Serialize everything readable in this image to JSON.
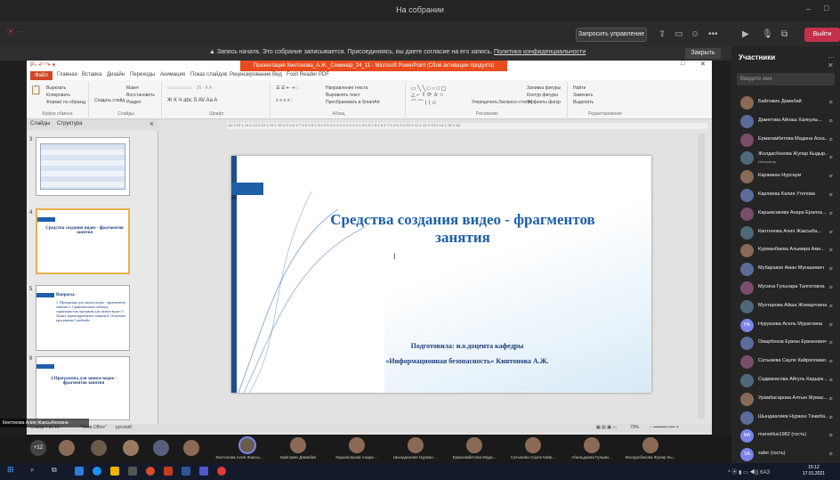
{
  "window_title": "На собрании",
  "toolbar": {
    "manage_label": "Запросить управление",
    "leave_label": "Выйти",
    "more_icon": "•••"
  },
  "banner": {
    "text": "Запись начата. Это собрание записывается. Присоединяясь, вы даете согласие на его запись.",
    "link": "Политика конфиденциальности",
    "close_label": "Закрыть"
  },
  "ppt": {
    "title": "Презентация Кинтонова_А.Ж._Семинар_24_11 - Microsoft PowerPoint (Сбой активации продукта)",
    "tabs": [
      "Файл",
      "Главная",
      "Вставка",
      "Дизайн",
      "Переходы",
      "Анимация",
      "Показ слайдов",
      "Рецензирование",
      "Вид",
      "Foxit Reader PDF"
    ],
    "ribbon_groups": [
      "Буфер обмена",
      "Слайды",
      "Шрифт",
      "Абзац",
      "Рисование",
      "Редактирование"
    ],
    "ribbon_items": [
      "Вырезать",
      "Копировать",
      "Формат по образцу",
      "Создать слайд",
      "Макет",
      "Восстановить",
      "Раздел",
      "Направление текста",
      "Выровнять текст",
      "Преобразовать в SmartArt",
      "Упорядочить",
      "Экспресс-стили",
      "Заливка фигуры",
      "Контур фигуры",
      "Эффекты фигур",
      "Найти",
      "Заменить",
      "Выделить"
    ],
    "pane_tabs": [
      "Слайды",
      "Структура"
    ],
    "ruler": "·16·1·15·1·14·1·13·1·12·1·11·1·10·1·9·1·8·1·7·1·6·1·5·1·4·1·3·1·2·1·1·1·0·1·1·1·2·1·3·1·4·1·5·1·6·1·7·1·8·1·9·1·10·1·11·1·12·1·13·1·14·1·15·1·16·",
    "thumbs": [
      {
        "num": "3"
      },
      {
        "num": "4",
        "title": "Средства создания видео - фрагментов занятия"
      },
      {
        "num": "5",
        "title": "Вопросы:",
        "lines": "1. Программы для записи видео - фрагментов занятия 2. Сравнительная таблица характеристик программ для записи видео 3. Захват экрана фрагмента занятия 4. Описание программы CamStudio"
      },
      {
        "num": "6",
        "title": "1.Программы для записи видео - фрагментов занятия"
      }
    ],
    "slide_title": "Средства создания видео - фрагментов занятия",
    "slide_sub1": "Подготовила: и.о.доцента кафедры",
    "slide_sub2": "«Информационная безопасность» Кинтонова А.Ж.",
    "status_left": "Слайд 4 из 10",
    "status_theme": "\"Тема Office\"",
    "status_lang": "русский",
    "zoom": "70%"
  },
  "presenter_name": "Кинтонова Алия Жаксыбековна",
  "sidebar": {
    "header": "Участники",
    "search_placeholder": "Введите имя",
    "participants": [
      {
        "name": "Байгожин Дамабай",
        "init": ""
      },
      {
        "name": "Даметова Айнаш Халкулы...",
        "init": ""
      },
      {
        "name": "Ермагамбетова Мадина Аскa...",
        "init": ""
      },
      {
        "name": "Жолдасбекова Жупар Кыдыр...",
        "init": "",
        "role": "Инициатор"
      },
      {
        "name": "Каракман Нурсаум",
        "init": ""
      },
      {
        "name": "Карлиева Калия Утепова",
        "init": ""
      },
      {
        "name": "Карымсакова Анара Ералха...",
        "init": ""
      },
      {
        "name": "Кинтонова Алия Жаксыба...",
        "init": ""
      },
      {
        "name": "Курманбаева Альмира Ами...",
        "init": ""
      },
      {
        "name": "Мубараков Аман Мукашевич",
        "init": ""
      },
      {
        "name": "Мусина Гульнара Талгатовна",
        "init": ""
      },
      {
        "name": "Мухтарова Айша Жомартовна",
        "init": ""
      },
      {
        "name": "Нурушева Асель Муратовна",
        "init": "НА"
      },
      {
        "name": "Омарбеков Ержан Ержанович",
        "init": ""
      },
      {
        "name": "Сатыаева Сауле Кайролламо...",
        "init": ""
      },
      {
        "name": "Садвакасова Айгуль Кадырк...",
        "init": ""
      },
      {
        "name": "Урамбасарова Алтын Жумас...",
        "init": ""
      },
      {
        "name": "Шындаалиев Нуржан Тажиба...",
        "init": ""
      },
      {
        "name": "marvellus1982 (гость)",
        "init": "MA"
      },
      {
        "name": "safer (гость)",
        "init": "SA"
      }
    ]
  },
  "strip": {
    "plus_count": "+12",
    "tiles": [
      {
        "name": "Кинтонова Алия Жаксы..."
      },
      {
        "name": "Байгожин Дамабай"
      },
      {
        "name": "Карымсакова Анара ..."
      },
      {
        "name": "Шындаалиев Нуржан ..."
      },
      {
        "name": "Ермагамбетова Мади..."
      },
      {
        "name": "Сатыаева Сауле Кайр..."
      },
      {
        "name": "Абильдаева Гульми..."
      },
      {
        "name": "Жолдасбекова Жупар Кы..."
      }
    ]
  },
  "taskbar": {
    "time": "15:12",
    "date": "17.01.2021",
    "lang": "КАЗ"
  }
}
